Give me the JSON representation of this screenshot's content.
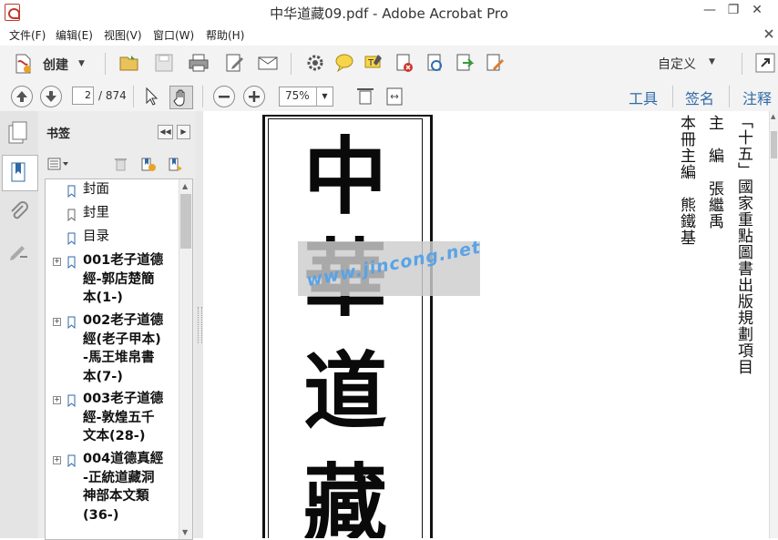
{
  "window": {
    "title": "中华道藏09.pdf - Adobe Acrobat Pro",
    "minimize_icon": "minimize-icon",
    "restore_icon": "restore-icon",
    "close_icon": "close-icon"
  },
  "menu": {
    "items": [
      "文件(F)",
      "编辑(E)",
      "视图(V)",
      "窗口(W)",
      "帮助(H)"
    ]
  },
  "toolbar": {
    "create_label": "创建",
    "customize_label": "自定义",
    "icons": [
      "create-pdf-icon",
      "open-folder-icon",
      "save-icon",
      "print-icon",
      "edit-icon",
      "email-icon",
      "settings-icon",
      "comment-icon",
      "highlight-icon",
      "delete-page-icon",
      "rotate-icon",
      "export-icon",
      "sign-icon",
      "expand-icon"
    ]
  },
  "nav": {
    "current_page": "2",
    "total_pages": "/ 874",
    "zoom": "75%",
    "tabs": [
      "工具",
      "签名",
      "注释"
    ]
  },
  "bookmarks": {
    "title": "书签",
    "items": [
      {
        "label": "封面",
        "expandable": false
      },
      {
        "label": "封里",
        "expandable": false
      },
      {
        "label": "目录",
        "expandable": false
      },
      {
        "label": "001老子道德經-郭店楚簡本(1-)",
        "lines": [
          "001老子道德",
          "經-郭店楚簡",
          "本(1-)"
        ],
        "expandable": true
      },
      {
        "label": "002老子道德經(老子甲本)-馬王堆帛書本(7-)",
        "lines": [
          "002老子道德",
          "經(老子甲本)",
          "-馬王堆帛書",
          "本(7-)"
        ],
        "expandable": true
      },
      {
        "label": "003老子道德經-敦煌五千文本(28-)",
        "lines": [
          "003老子道德",
          "經-敦煌五千",
          "文本(28-)"
        ],
        "expandable": true
      },
      {
        "label": "004道德真經-正統道藏洞神部本文類(36-)",
        "lines": [
          "004道德真經",
          "-正統道藏洞",
          "神部本文類",
          "(36-)"
        ],
        "expandable": true
      }
    ]
  },
  "document": {
    "title_chars": [
      "中",
      "華",
      "道",
      "藏"
    ],
    "columns": [
      "「十五」國家重點圖書出版規劃項目",
      "主　編　張繼禹",
      "本冊主編　熊鐵基"
    ],
    "watermark": "www.jincong.net"
  }
}
